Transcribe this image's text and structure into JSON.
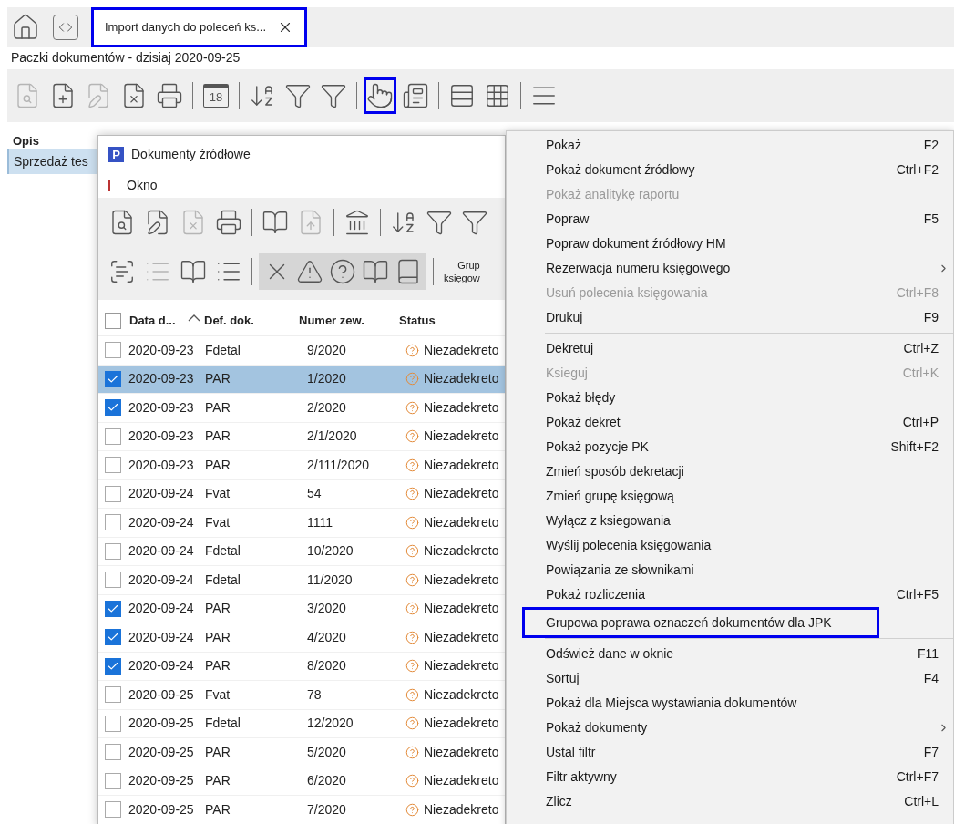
{
  "tab_bar": {
    "tab": {
      "label": "Import danych do poleceń ks...",
      "marked": true
    }
  },
  "page_title": "Paczki dokumentów - dzisiaj 2020-09-25",
  "main_toolbar": [
    {
      "kind": "button",
      "disabled": true,
      "marked": false
    },
    {
      "kind": "button",
      "disabled": false,
      "marked": false
    },
    {
      "kind": "button",
      "disabled": true,
      "marked": false
    },
    {
      "kind": "button",
      "disabled": false,
      "marked": false
    },
    {
      "kind": "button",
      "disabled": false,
      "marked": false
    },
    {
      "kind": "separator"
    },
    {
      "kind": "calendar",
      "label": "18",
      "disabled": false,
      "marked": false
    },
    {
      "kind": "separator"
    },
    {
      "kind": "button",
      "disabled": false,
      "marked": false
    },
    {
      "kind": "button",
      "disabled": false,
      "marked": false
    },
    {
      "kind": "button",
      "disabled": false,
      "marked": false
    },
    {
      "kind": "separator"
    },
    {
      "kind": "button",
      "disabled": false,
      "marked": true
    },
    {
      "kind": "button",
      "disabled": false,
      "marked": false
    },
    {
      "kind": "separator"
    },
    {
      "kind": "button",
      "disabled": false,
      "marked": false
    },
    {
      "kind": "button",
      "disabled": false,
      "marked": false
    },
    {
      "kind": "separator"
    },
    {
      "kind": "button",
      "disabled": false,
      "marked": false
    }
  ],
  "list": {
    "header": "Opis",
    "rows": [
      {
        "text": "Sprzedaż tes",
        "selected": true
      }
    ]
  },
  "source_window": {
    "logo_letter": "P",
    "title": "Dokumenty źródłowe",
    "menu": [
      "Okno"
    ],
    "toolbar_1": [
      {
        "kind": "button",
        "disabled": false
      },
      {
        "kind": "button",
        "disabled": false
      },
      {
        "kind": "button",
        "disabled": true
      },
      {
        "kind": "button",
        "disabled": false
      },
      {
        "kind": "separator"
      },
      {
        "kind": "button",
        "disabled": false
      },
      {
        "kind": "button",
        "disabled": true
      },
      {
        "kind": "separator"
      },
      {
        "kind": "button",
        "disabled": false
      },
      {
        "kind": "separator"
      },
      {
        "kind": "button",
        "disabled": false
      },
      {
        "kind": "button",
        "disabled": false
      },
      {
        "kind": "button",
        "disabled": false
      },
      {
        "kind": "separator"
      }
    ],
    "toolbar_2": [
      {
        "kind": "button",
        "disabled": false
      },
      {
        "kind": "button",
        "disabled": true
      },
      {
        "kind": "button",
        "disabled": false
      },
      {
        "kind": "button",
        "disabled": false
      },
      {
        "kind": "separator"
      },
      {
        "kind": "group",
        "buttons": [
          {
            "disabled": false
          },
          {
            "disabled": false
          },
          {
            "disabled": false
          },
          {
            "disabled": false
          },
          {
            "disabled": false
          }
        ]
      },
      {
        "kind": "separator"
      },
      {
        "kind": "text",
        "lines": [
          "Grup",
          "księgow"
        ]
      }
    ],
    "select_all": {
      "checked": false
    },
    "columns": [
      "Data d...",
      "Def. dok.",
      "Numer zew.",
      "Status"
    ],
    "rows": [
      {
        "checked": false,
        "selected": false,
        "date": "2020-09-23",
        "def": "Fdetal",
        "number": "9/2020",
        "status": "Niezadekreto"
      },
      {
        "checked": true,
        "selected": true,
        "date": "2020-09-23",
        "def": "PAR",
        "number": "1/2020",
        "status": "Niezadekreto"
      },
      {
        "checked": true,
        "selected": false,
        "date": "2020-09-23",
        "def": "PAR",
        "number": "2/2020",
        "status": "Niezadekreto"
      },
      {
        "checked": false,
        "selected": false,
        "date": "2020-09-23",
        "def": "PAR",
        "number": "2/1/2020",
        "status": "Niezadekreto"
      },
      {
        "checked": false,
        "selected": false,
        "date": "2020-09-23",
        "def": "PAR",
        "number": "2/111/2020",
        "status": "Niezadekreto"
      },
      {
        "checked": false,
        "selected": false,
        "date": "2020-09-24",
        "def": "Fvat",
        "number": "54",
        "status": "Niezadekreto"
      },
      {
        "checked": false,
        "selected": false,
        "date": "2020-09-24",
        "def": "Fvat",
        "number": "1111",
        "status": "Niezadekreto"
      },
      {
        "checked": false,
        "selected": false,
        "date": "2020-09-24",
        "def": "Fdetal",
        "number": "10/2020",
        "status": "Niezadekreto"
      },
      {
        "checked": false,
        "selected": false,
        "date": "2020-09-24",
        "def": "Fdetal",
        "number": "11/2020",
        "status": "Niezadekreto"
      },
      {
        "checked": true,
        "selected": false,
        "date": "2020-09-24",
        "def": "PAR",
        "number": "3/2020",
        "status": "Niezadekreto"
      },
      {
        "checked": true,
        "selected": false,
        "date": "2020-09-24",
        "def": "PAR",
        "number": "4/2020",
        "status": "Niezadekreto"
      },
      {
        "checked": true,
        "selected": false,
        "date": "2020-09-24",
        "def": "PAR",
        "number": "8/2020",
        "status": "Niezadekreto"
      },
      {
        "checked": false,
        "selected": false,
        "date": "2020-09-25",
        "def": "Fvat",
        "number": "78",
        "status": "Niezadekreto"
      },
      {
        "checked": false,
        "selected": false,
        "date": "2020-09-25",
        "def": "Fdetal",
        "number": "12/2020",
        "status": "Niezadekreto"
      },
      {
        "checked": false,
        "selected": false,
        "date": "2020-09-25",
        "def": "PAR",
        "number": "5/2020",
        "status": "Niezadekreto"
      },
      {
        "checked": false,
        "selected": false,
        "date": "2020-09-25",
        "def": "PAR",
        "number": "6/2020",
        "status": "Niezadekreto"
      },
      {
        "checked": false,
        "selected": false,
        "date": "2020-09-25",
        "def": "PAR",
        "number": "7/2020",
        "status": "Niezadekreto"
      }
    ]
  },
  "context_menu": {
    "items": [
      {
        "kind": "item",
        "label": "Pokaż",
        "shortcut": "F2",
        "disabled": false,
        "submenu": false,
        "marked": false
      },
      {
        "kind": "item",
        "label": "Pokaż dokument źródłowy",
        "shortcut": "Ctrl+F2",
        "disabled": false,
        "submenu": false,
        "marked": false
      },
      {
        "kind": "item",
        "label": "Pokaż analitykę raportu",
        "disabled": true,
        "submenu": false,
        "marked": false
      },
      {
        "kind": "item",
        "label": "Popraw",
        "shortcut": "F5",
        "disabled": false,
        "submenu": false,
        "marked": false
      },
      {
        "kind": "item",
        "label": "Popraw dokument źródłowy HM",
        "disabled": false,
        "submenu": false,
        "marked": false
      },
      {
        "kind": "item",
        "label": "Rezerwacja numeru księgowego",
        "disabled": false,
        "submenu": true,
        "marked": false
      },
      {
        "kind": "item",
        "label": "Usuń polecenia księgowania",
        "shortcut": "Ctrl+F8",
        "disabled": true,
        "submenu": false,
        "marked": false
      },
      {
        "kind": "item",
        "label": "Drukuj",
        "shortcut": "F9",
        "disabled": false,
        "submenu": false,
        "marked": false
      },
      {
        "kind": "separator"
      },
      {
        "kind": "item",
        "label": "Dekretuj",
        "shortcut": "Ctrl+Z",
        "disabled": false,
        "submenu": false,
        "marked": false
      },
      {
        "kind": "item",
        "label": "Ksieguj",
        "shortcut": "Ctrl+K",
        "disabled": true,
        "submenu": false,
        "marked": false
      },
      {
        "kind": "item",
        "label": "Pokaż błędy",
        "disabled": false,
        "submenu": false,
        "marked": false
      },
      {
        "kind": "item",
        "label": "Pokaż dekret",
        "shortcut": "Ctrl+P",
        "disabled": false,
        "submenu": false,
        "marked": false
      },
      {
        "kind": "item",
        "label": "Pokaż pozycje PK",
        "shortcut": "Shift+F2",
        "disabled": false,
        "submenu": false,
        "marked": false
      },
      {
        "kind": "item",
        "label": "Zmień sposób dekretacji",
        "disabled": false,
        "submenu": false,
        "marked": false
      },
      {
        "kind": "item",
        "label": "Zmień grupę księgową",
        "disabled": false,
        "submenu": false,
        "marked": false
      },
      {
        "kind": "item",
        "label": "Wyłącz z ksiegowania",
        "disabled": false,
        "submenu": false,
        "marked": false
      },
      {
        "kind": "item",
        "label": "Wyślij polecenia księgowania",
        "disabled": false,
        "submenu": false,
        "marked": false
      },
      {
        "kind": "item",
        "label": "Powiązania ze słownikami",
        "disabled": false,
        "submenu": false,
        "marked": false
      },
      {
        "kind": "item",
        "label": "Pokaż rozliczenia",
        "shortcut": "Ctrl+F5",
        "disabled": false,
        "submenu": false,
        "marked": false
      },
      {
        "kind": "item",
        "label": "Grupowa poprawa oznaczeń dokumentów dla JPK",
        "disabled": false,
        "submenu": false,
        "marked": true
      },
      {
        "kind": "separator"
      },
      {
        "kind": "item",
        "label": "Odśwież dane w oknie",
        "shortcut": "F11",
        "disabled": false,
        "submenu": false,
        "marked": false
      },
      {
        "kind": "item",
        "label": "Sortuj",
        "shortcut": "F4",
        "disabled": false,
        "submenu": false,
        "marked": false
      },
      {
        "kind": "item",
        "label": "Pokaż dla Miejsca wystawiania dokumentów",
        "disabled": false,
        "submenu": false,
        "marked": false
      },
      {
        "kind": "item",
        "label": "Pokaż dokumenty",
        "disabled": false,
        "submenu": true,
        "marked": false
      },
      {
        "kind": "item",
        "label": "Ustal filtr",
        "shortcut": "F7",
        "disabled": false,
        "submenu": false,
        "marked": false
      },
      {
        "kind": "item",
        "label": "Filtr aktywny",
        "shortcut": "Ctrl+F7",
        "disabled": false,
        "submenu": false,
        "marked": false
      },
      {
        "kind": "item",
        "label": "Zlicz",
        "shortcut": "Ctrl+L",
        "disabled": false,
        "submenu": false,
        "marked": false
      }
    ]
  }
}
